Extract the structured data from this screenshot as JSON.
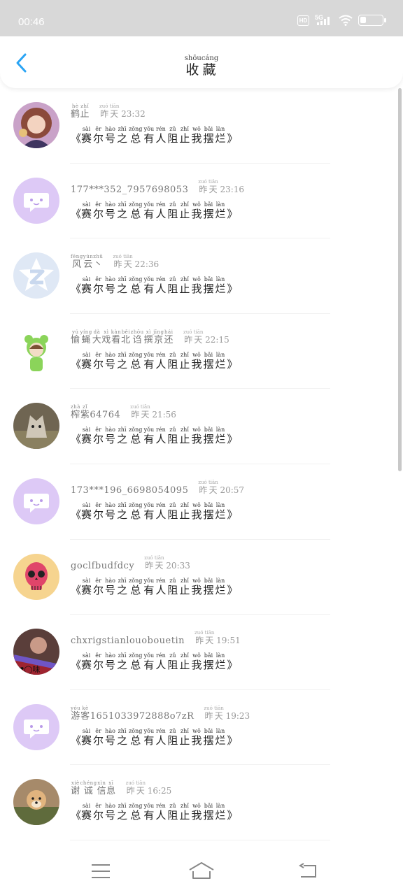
{
  "status_bar": {
    "time": "00:46",
    "hd_label": "HD",
    "network_label": "5G",
    "battery_level": 0.25,
    "icons": [
      "hd-icon",
      "signal-5g-icon",
      "wifi-icon",
      "battery-icon"
    ]
  },
  "header": {
    "title": "收藏",
    "title_pinyin": "shōucáng",
    "back_icon": "chevron-left-icon",
    "accent_color": "#2aa4f4"
  },
  "post_title": {
    "open_quote": "《",
    "close_quote": "》",
    "chars": [
      {
        "hanzi": "赛",
        "pinyin": "sài"
      },
      {
        "hanzi": "尔",
        "pinyin": "ěr"
      },
      {
        "hanzi": "号",
        "pinyin": "hào"
      },
      {
        "hanzi": "之",
        "pinyin": "zhī"
      },
      {
        "hanzi": "总",
        "pinyin": "zǒng"
      },
      {
        "hanzi": "有",
        "pinyin": "yǒu"
      },
      {
        "hanzi": "人",
        "pinyin": "rén"
      },
      {
        "hanzi": "阻",
        "pinyin": "zǔ"
      },
      {
        "hanzi": "止",
        "pinyin": "zhǐ"
      },
      {
        "hanzi": "我",
        "pinyin": "wǒ"
      },
      {
        "hanzi": "摆",
        "pinyin": "bǎi"
      },
      {
        "hanzi": "烂",
        "pinyin": "làn"
      }
    ]
  },
  "items": [
    {
      "avatar": "anime-girl-avatar",
      "name_parts": [
        {
          "text": "鹤",
          "ruby": "hè"
        },
        {
          "text": "止",
          "ruby": "zhǐ"
        }
      ],
      "time_label": "昨天",
      "time_ruby": "zuó tiān",
      "time": "23:32"
    },
    {
      "avatar": "default-chat-avatar",
      "name_parts": [
        {
          "text": "177***352_7957698053",
          "ruby": ""
        }
      ],
      "time_label": "昨天",
      "time_ruby": "zuó tiān",
      "time": "23:16"
    },
    {
      "avatar": "qq-star-avatar",
      "name_parts": [
        {
          "text": "风",
          "ruby": "fēng"
        },
        {
          "text": "云",
          "ruby": "yún"
        },
        {
          "text": "丶",
          "ruby": "zhǔ"
        }
      ],
      "time_label": "昨天",
      "time_ruby": "zuó tiān",
      "time": "22:36"
    },
    {
      "avatar": "frog-hood-avatar",
      "name_parts": [
        {
          "text": "愉",
          "ruby": "yú"
        },
        {
          "text": "蝇",
          "ruby": "yíng"
        },
        {
          "text": "大",
          "ruby": "dà"
        },
        {
          "text": "戏",
          "ruby": "xì"
        },
        {
          "text": "看",
          "ruby": "kàn"
        },
        {
          "text": "北",
          "ruby": "běi"
        },
        {
          "text": "诌",
          "ruby": "zhōu"
        },
        {
          "text": "撰",
          "ruby": "xì"
        },
        {
          "text": "京",
          "ruby": "jīng"
        },
        {
          "text": "还",
          "ruby": "hái"
        }
      ],
      "time_label": "昨天",
      "time_ruby": "zuó tiān",
      "time": "22:15"
    },
    {
      "avatar": "wolf-photo-avatar",
      "name_parts": [
        {
          "text": "榨",
          "ruby": "zhà"
        },
        {
          "text": "紫",
          "ruby": "zǐ"
        },
        {
          "text": "64764",
          "ruby": ""
        }
      ],
      "time_label": "昨天",
      "time_ruby": "zuó tiān",
      "time": "21:56"
    },
    {
      "avatar": "default-chat-avatar",
      "name_parts": [
        {
          "text": "173***196_6698054095",
          "ruby": ""
        }
      ],
      "time_label": "昨天",
      "time_ruby": "zuó tiān",
      "time": "20:57"
    },
    {
      "avatar": "sugar-skull-avatar",
      "name_parts": [
        {
          "text": "goclfbudfdcy",
          "ruby": ""
        }
      ],
      "time_label": "昨天",
      "time_ruby": "zuó tiān",
      "time": "20:33"
    },
    {
      "avatar": "girl-photo-avatar",
      "name_parts": [
        {
          "text": "chxrigstianlouobouetin",
          "ruby": ""
        }
      ],
      "time_label": "昨天",
      "time_ruby": "zuó tiān",
      "time": "19:51"
    },
    {
      "avatar": "default-chat-avatar",
      "name_parts": [
        {
          "text": "游",
          "ruby": "yóu"
        },
        {
          "text": "客",
          "ruby": "kè"
        },
        {
          "text": "1651033972888o7zR",
          "ruby": ""
        }
      ],
      "time_label": "昨天",
      "time_ruby": "zuó tiān",
      "time": "19:23"
    },
    {
      "avatar": "shiba-dog-avatar",
      "name_parts": [
        {
          "text": "谢",
          "ruby": "xiè"
        },
        {
          "text": "诚",
          "ruby": "chéng"
        },
        {
          "text": "信",
          "ruby": "xìn"
        },
        {
          "text": "息",
          "ruby": "xī"
        }
      ],
      "time_label": "昨天",
      "time_ruby": "zuó tiān",
      "time": "16:25"
    }
  ],
  "nav_bar": {
    "buttons": [
      "menu-icon",
      "home-icon",
      "back-icon"
    ]
  }
}
